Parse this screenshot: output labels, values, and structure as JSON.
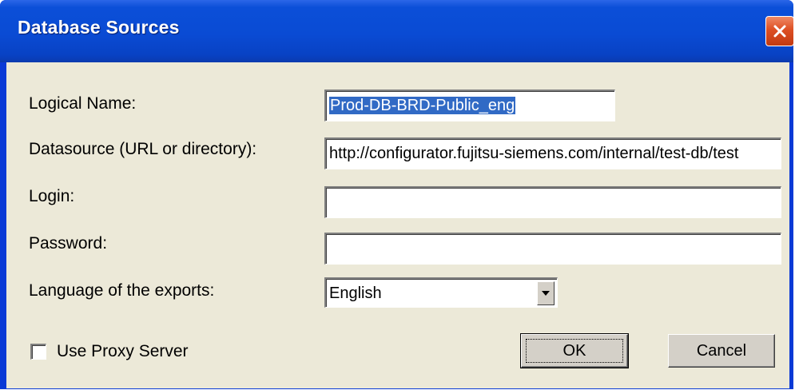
{
  "window": {
    "title": "Database Sources"
  },
  "form": {
    "logical_name_label": "Logical Name:",
    "logical_name_value": "Prod-DB-BRD-Public_eng",
    "datasource_label": "Datasource (URL or directory):",
    "datasource_value": "http://configurator.fujitsu-siemens.com/internal/test-db/test",
    "login_label": "Login:",
    "login_value": "",
    "password_label": "Password:",
    "password_value": "",
    "language_label": "Language of the exports:",
    "language_selected": "English",
    "proxy_label": "Use Proxy Server",
    "proxy_checked": false
  },
  "buttons": {
    "ok_label": "OK",
    "cancel_label": "Cancel"
  },
  "icons": {
    "close": "close-icon",
    "dropdown": "chevron-down-icon"
  },
  "colors": {
    "titlebar": "#0a4bd4",
    "close_button": "#dd4f23",
    "dialog_background": "#ece9d8",
    "selection_highlight": "#316ac5"
  }
}
